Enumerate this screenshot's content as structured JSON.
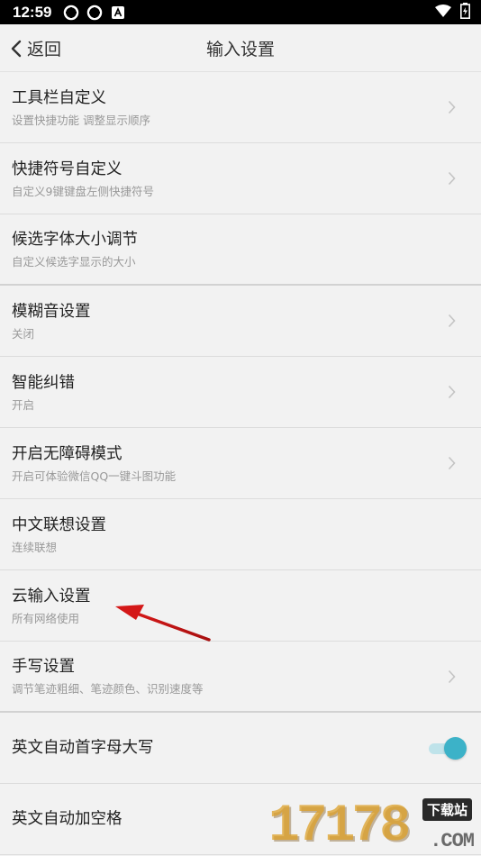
{
  "status_bar": {
    "time": "12:59"
  },
  "nav": {
    "back_label": "返回",
    "title": "输入设置"
  },
  "items": [
    {
      "title": "工具栏自定义",
      "subtitle": "设置快捷功能 调整显示顺序"
    },
    {
      "title": "快捷符号自定义",
      "subtitle": "自定义9键键盘左侧快捷符号"
    },
    {
      "title": "候选字体大小调节",
      "subtitle": "自定义候选字显示的大小"
    },
    {
      "title": "模糊音设置",
      "subtitle": "关闭"
    },
    {
      "title": "智能纠错",
      "subtitle": "开启"
    },
    {
      "title": "开启无障碍模式",
      "subtitle": "开启可体验微信QQ一键斗图功能"
    },
    {
      "title": "中文联想设置",
      "subtitle": "连续联想"
    },
    {
      "title": "云输入设置",
      "subtitle": "所有网络使用"
    },
    {
      "title": "手写设置",
      "subtitle": "调节笔迹粗细、笔迹颜色、识别速度等"
    },
    {
      "title": "英文自动首字母大写",
      "toggle_on": true
    },
    {
      "title": "英文自动加空格"
    }
  ],
  "colors": {
    "toggle_accent": "#3cb2c8",
    "arrow": "#e02020"
  },
  "watermark": {
    "digits": "17178",
    "badge": "下载站",
    "domain": ".COM"
  }
}
